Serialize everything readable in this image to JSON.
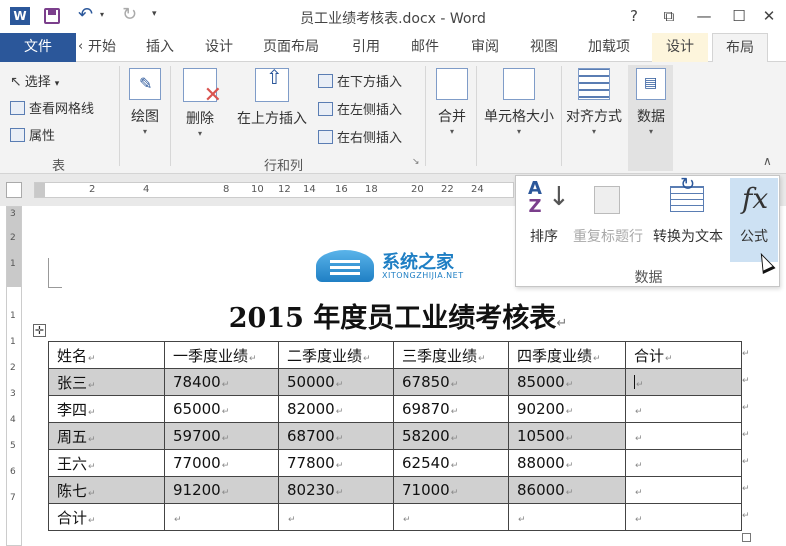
{
  "window": {
    "title": "员工业绩考核表.docx - Word",
    "word_icon_letter": "W",
    "help": "?",
    "restore": "⧉",
    "minimize": "—",
    "maximize": "☐",
    "close": "✕"
  },
  "qat": {
    "undo": "↶",
    "undo_dropdown": "▾",
    "redo": "↻",
    "customize": "▾"
  },
  "tabs": {
    "file": "文件",
    "scroll": "‹",
    "items": [
      "开始",
      "插入",
      "设计",
      "页面布局",
      "引用",
      "邮件",
      "审阅",
      "视图",
      "加载项",
      "设计",
      "布局"
    ],
    "contextual": [
      "设计",
      "布局"
    ],
    "active": "布局"
  },
  "ribbon": {
    "table_group": {
      "select": "选择",
      "select_arrow": "▾",
      "view_gridlines": "查看网格线",
      "properties": "属性",
      "label": "表"
    },
    "draw": {
      "draw_table": "绘图",
      "arrow": "▾"
    },
    "rows_columns": {
      "delete": "删除",
      "insert_above": "在上方插入",
      "insert_below": "在下方插入",
      "insert_left": "在左侧插入",
      "insert_right": "在右侧插入",
      "label": "行和列",
      "launcher": "↘"
    },
    "merge": {
      "label": "合并",
      "arrow": "▾"
    },
    "cell_size": {
      "label": "单元格大小",
      "arrow": "▾"
    },
    "alignment": {
      "label": "对齐方式",
      "arrow": "▾"
    },
    "data": {
      "label": "数据",
      "arrow": "▾"
    },
    "collapse": "∧"
  },
  "ruler": {
    "h_ticks": [
      "2",
      "4",
      "8",
      "10",
      "12",
      "14",
      "16",
      "18",
      "20",
      "22",
      "24"
    ],
    "v_ticks": [
      "3",
      "2",
      "1",
      "1",
      "1",
      "2",
      "3",
      "4",
      "5",
      "6",
      "7"
    ]
  },
  "data_dropdown": {
    "sort": "排序",
    "repeat_header": "重复标题行",
    "convert_to_text": "转换为文本",
    "formula": "公式",
    "formula_icon": "fx",
    "group_label": "数据",
    "sort_icon_a": "A",
    "sort_icon_z": "Z",
    "sort_arrow": "↓",
    "convert_arrow": "↻"
  },
  "watermark": {
    "cn": "系统之家",
    "en": "XITONGZHIJIA.NET"
  },
  "document": {
    "heading": "2015 年度员工业绩考核表",
    "para_mark": "↵",
    "table_handle": "✛",
    "headers": [
      "姓名",
      "一季度业绩",
      "二季度业绩",
      "三季度业绩",
      "四季度业绩",
      "合计"
    ],
    "rows": [
      [
        "张三",
        "78400",
        "50000",
        "67850",
        "85000",
        ""
      ],
      [
        "李四",
        "65000",
        "82000",
        "69870",
        "90200",
        ""
      ],
      [
        "周五",
        "59700",
        "68700",
        "58200",
        "10500",
        ""
      ],
      [
        "王六",
        "77000",
        "77800",
        "62540",
        "88000",
        ""
      ],
      [
        "陈七",
        "91200",
        "80230",
        "71000",
        "86000",
        ""
      ]
    ],
    "total_row": [
      "合计",
      "",
      "",
      "",
      "",
      ""
    ]
  }
}
